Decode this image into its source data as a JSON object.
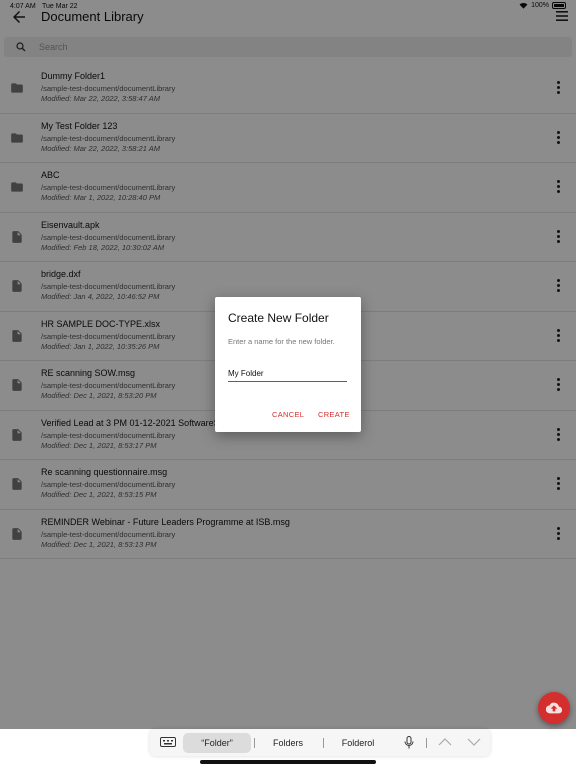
{
  "status": {
    "time": "4:07 AM",
    "date": "Tue Mar 22",
    "battery": "100%"
  },
  "header": {
    "title": "Document Library"
  },
  "search": {
    "placeholder": "Search"
  },
  "items": [
    {
      "type": "folder",
      "name": "Dummy Folder1",
      "path": "/sample-test-document/documentLibrary",
      "modified": "Modified: Mar 22, 2022, 3:58:47 AM"
    },
    {
      "type": "folder",
      "name": "My Test Folder 123",
      "path": "/sample-test-document/documentLibrary",
      "modified": "Modified: Mar 22, 2022, 3:58:21 AM"
    },
    {
      "type": "folder",
      "name": "ABC",
      "path": "/sample-test-document/documentLibrary",
      "modified": "Modified: Mar 1, 2022, 10:28:40 PM"
    },
    {
      "type": "file",
      "name": "Eisenvault.apk",
      "path": "/sample-test-document/documentLibrary",
      "modified": "Modified: Feb 18, 2022, 10:30:02 AM"
    },
    {
      "type": "file",
      "name": "bridge.dxf",
      "path": "/sample-test-document/documentLibrary",
      "modified": "Modified: Jan 4, 2022, 10:46:52 PM"
    },
    {
      "type": "file",
      "name": "HR SAMPLE DOC-TYPE.xlsx",
      "path": "/sample-test-document/documentLibrary",
      "modified": "Modified: Jan 1, 2022, 10:35:26 PM"
    },
    {
      "type": "file",
      "name": "RE scanning SOW.msg",
      "path": "/sample-test-document/documentLibrary",
      "modified": "Modified: Dec 1, 2021, 8:53:20 PM"
    },
    {
      "type": "file",
      "name": "Verified Lead at 3 PM 01-12-2021 SoftwareS",
      "path": "/sample-test-document/documentLibrary",
      "modified": "Modified: Dec 1, 2021, 8:53:17 PM"
    },
    {
      "type": "file",
      "name": "Re scanning questionnaire.msg",
      "path": "/sample-test-document/documentLibrary",
      "modified": "Modified: Dec 1, 2021, 8:53:15 PM"
    },
    {
      "type": "file",
      "name": "REMINDER Webinar - Future Leaders Programme at ISB.msg",
      "path": "/sample-test-document/documentLibrary",
      "modified": "Modified: Dec 1, 2021, 8:53:13 PM"
    }
  ],
  "dialog": {
    "title": "Create New Folder",
    "subtitle": "Enter a name for the new folder.",
    "input_value": "My Folder",
    "cancel": "CANCEL",
    "create": "CREATE"
  },
  "keyboard": {
    "suggestions": [
      "“Folder”",
      "Folders",
      "Folderol"
    ]
  },
  "colors": {
    "accent": "#d32f2f",
    "overlay": "rgba(0,0,0,0.45)"
  }
}
